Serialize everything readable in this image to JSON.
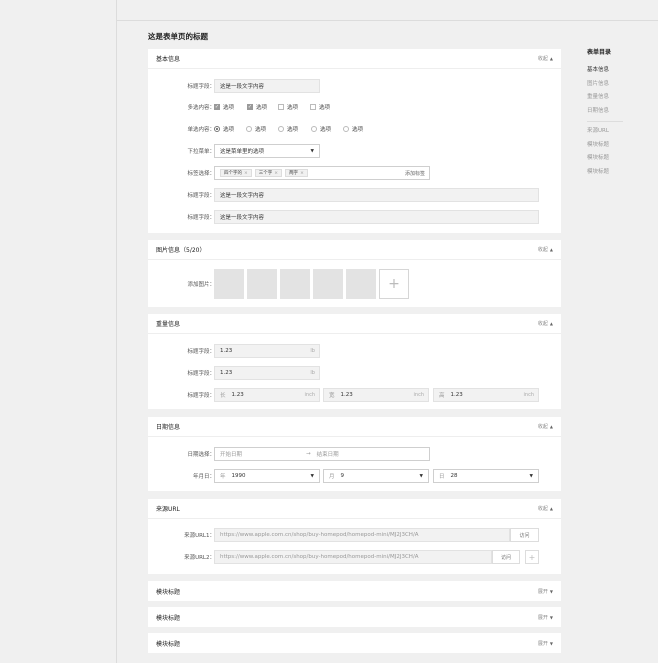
{
  "page_title": "这是表单页的标题",
  "sections": {
    "basic": {
      "title": "基本信息",
      "toggle": "收起",
      "f1": {
        "label": "标题字段：",
        "value": "这是一段文字内容"
      },
      "checkbox": {
        "label": "多选内容：",
        "options": [
          {
            "text": "选项",
            "checked": true
          },
          {
            "text": "选项",
            "checked": true
          },
          {
            "text": "选项",
            "checked": false
          },
          {
            "text": "选项",
            "checked": false
          }
        ]
      },
      "radio": {
        "label": "单选内容：",
        "options": [
          "选项",
          "选项",
          "选项",
          "选项",
          "选项"
        ],
        "selected_index": 0
      },
      "dropdown": {
        "label": "下拉菜单：",
        "value": "这是菜单里的选项"
      },
      "tags": {
        "label": "标签选择：",
        "items": [
          "四个字的",
          "三个字",
          "两字"
        ],
        "add": "添加标签"
      },
      "f2": {
        "label": "标题字段：",
        "value": "这是一段文字内容"
      },
      "f3": {
        "label": "标题字段：",
        "value": "这是一段文字内容"
      }
    },
    "images": {
      "title": "图片信息（5/20）",
      "toggle": "收起",
      "label": "添加图片：",
      "add_symbol": "+"
    },
    "weight": {
      "title": "重量信息",
      "toggle": "收起",
      "r1": {
        "label": "标题字段：",
        "value": "1.23",
        "unit": "lb"
      },
      "r2": {
        "label": "标题字段：",
        "value": "1.23",
        "unit": "lb"
      },
      "r3": {
        "label": "标题字段：",
        "dims": [
          {
            "prefix": "长",
            "value": "1.23",
            "unit": "inch"
          },
          {
            "prefix": "宽",
            "value": "1.23",
            "unit": "inch"
          },
          {
            "prefix": "高",
            "value": "1.23",
            "unit": "inch"
          }
        ]
      }
    },
    "date": {
      "title": "日期信息",
      "toggle": "收起",
      "range": {
        "label": "日期选择：",
        "start": "开始日期",
        "arrow": "→",
        "end": "结束日期"
      },
      "ymd": {
        "label": "年月日：",
        "year_prefix": "年",
        "year": "1990",
        "month_prefix": "月",
        "month": "9",
        "day_prefix": "日",
        "day": "28"
      }
    },
    "url": {
      "title": "来源URL",
      "toggle": "收起",
      "u1": {
        "label": "来源URL1：",
        "value": "https://www.apple.com.cn/shop/buy-homepod/homepod-mini/MJ2J3CH/A",
        "button": "访问"
      },
      "u2": {
        "label": "来源URL2：",
        "value": "https://www.apple.com.cn/shop/buy-homepod/homepod-mini/MJ2J3CH/A",
        "button": "访问",
        "add": "+"
      }
    },
    "m1": {
      "title": "模块标题",
      "toggle": "展开"
    },
    "m2": {
      "title": "模块标题",
      "toggle": "展开"
    },
    "m3": {
      "title": "模块标题",
      "toggle": "展开"
    }
  },
  "toc": {
    "title": "表单目录",
    "group1": [
      "基本信息",
      "图片信息",
      "重量信息",
      "日期信息"
    ],
    "group2": [
      "来源URL",
      "模块标题",
      "模块标题",
      "模块标题"
    ],
    "active_index": 0
  },
  "colors": {
    "background": "#f0f0f0",
    "card": "#ffffff",
    "field": "#f2f2f2",
    "checked": "#999999"
  }
}
